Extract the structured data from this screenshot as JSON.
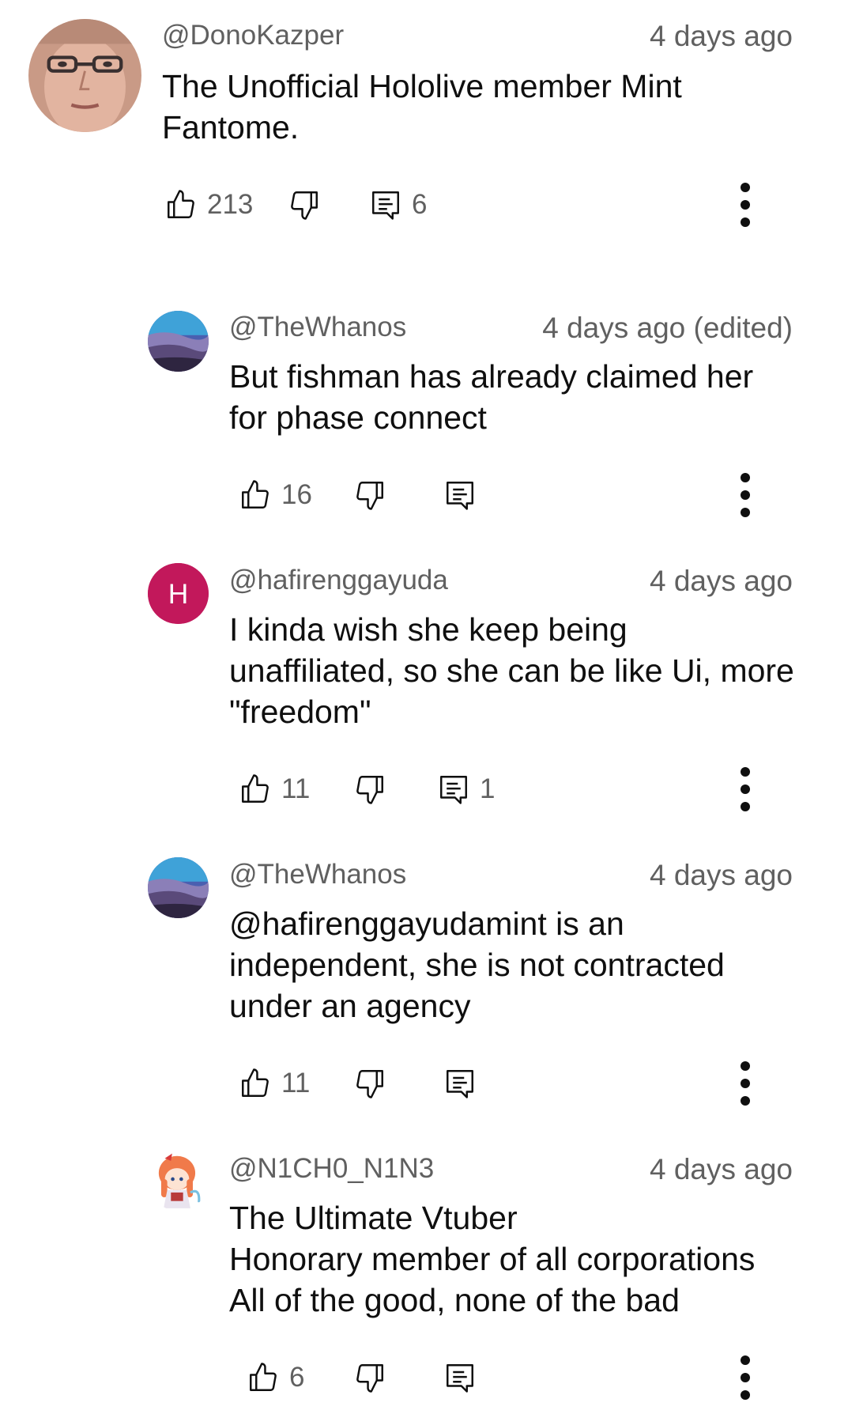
{
  "comments": [
    {
      "author": "@DonoKazper",
      "time": "4 days ago",
      "text": "The Unofficial Hololive member Mint\nFantome.",
      "likes": "213",
      "replies": "6",
      "avatar": "photo-face"
    },
    {
      "author": "@TheWhanos",
      "time": "4 days ago (edited)",
      "text": "But fishman has already claimed her\nfor phase connect",
      "likes": "16",
      "replies": "",
      "avatar": "landscape"
    },
    {
      "author": "@hafirenggayuda",
      "time": "4 days ago",
      "text": "I kinda wish she keep being\nunaffiliated, so she can be like Ui, more\n\"freedom\"",
      "likes": "11",
      "replies": "1",
      "avatar": "letter",
      "avatar_letter": "H",
      "avatar_color": "#c2185b"
    },
    {
      "author": "@TheWhanos",
      "time": "4 days ago",
      "text": "@hafirenggayudamint is an\nindependent, she is not contracted\nunder an agency",
      "likes": "11",
      "replies": "",
      "avatar": "landscape"
    },
    {
      "author": "@N1CH0_N1N3",
      "time": "4 days ago",
      "text": "The Ultimate Vtuber\nHonorary member of all corporations\nAll of the good, none of the bad",
      "likes": "6",
      "replies": "",
      "avatar": "anime-character"
    }
  ],
  "icons": {
    "like": "thumbs-up-icon",
    "dislike": "thumbs-down-icon",
    "reply": "reply-icon",
    "more": "more-vert-icon"
  },
  "colors": {
    "text": "#0f0f0f",
    "meta": "#606060"
  }
}
